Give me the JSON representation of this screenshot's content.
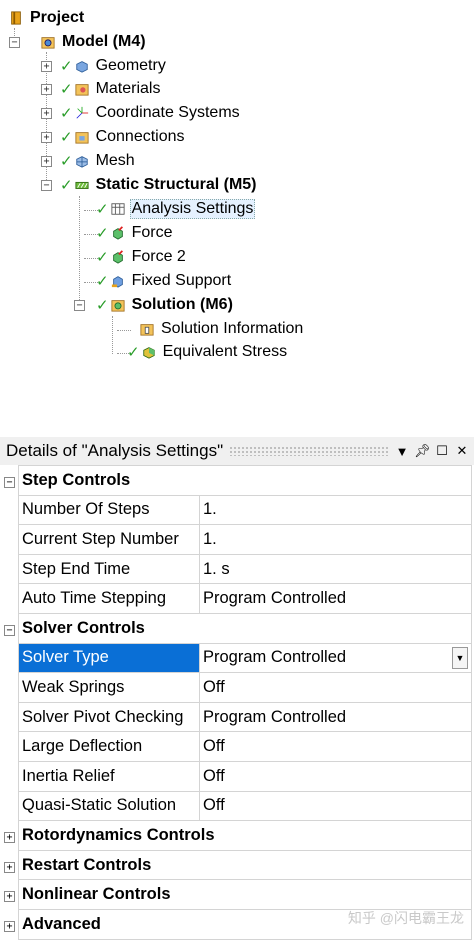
{
  "tree": {
    "root": "Project",
    "model": "Model (M4)",
    "items": {
      "geometry": "Geometry",
      "materials": "Materials",
      "coordinate_systems": "Coordinate Systems",
      "connections": "Connections",
      "mesh": "Mesh",
      "static_structural": "Static Structural (M5)",
      "analysis_settings": "Analysis Settings",
      "force": "Force",
      "force2": "Force 2",
      "fixed_support": "Fixed Support",
      "solution": "Solution (M6)",
      "solution_information": "Solution Information",
      "equivalent_stress": "Equivalent Stress"
    }
  },
  "details": {
    "title": "Details of \"Analysis Settings\"",
    "groups": {
      "step_controls": "Step Controls",
      "solver_controls": "Solver Controls",
      "rotordynamics": "Rotordynamics Controls",
      "restart": "Restart Controls",
      "nonlinear": "Nonlinear Controls",
      "advanced": "Advanced"
    },
    "rows": {
      "number_of_steps": {
        "name": "Number Of Steps",
        "value": "1."
      },
      "current_step": {
        "name": "Current Step Number",
        "value": "1."
      },
      "step_end_time": {
        "name": "Step End Time",
        "value": "1. s"
      },
      "auto_time_stepping": {
        "name": "Auto Time Stepping",
        "value": "Program Controlled"
      },
      "solver_type": {
        "name": "Solver Type",
        "value": "Program Controlled"
      },
      "weak_springs": {
        "name": "Weak Springs",
        "value": "Off"
      },
      "pivot_checking": {
        "name": "Solver Pivot Checking",
        "value": "Program Controlled"
      },
      "large_deflection": {
        "name": "Large Deflection",
        "value": "Off"
      },
      "inertia_relief": {
        "name": "Inertia Relief",
        "value": "Off"
      },
      "quasi_static": {
        "name": "Quasi-Static Solution",
        "value": "Off"
      }
    }
  },
  "watermark": "知乎 @闪电霸王龙",
  "colors": {
    "selection": "#0a6fd6",
    "check": "#2a9d2a"
  }
}
